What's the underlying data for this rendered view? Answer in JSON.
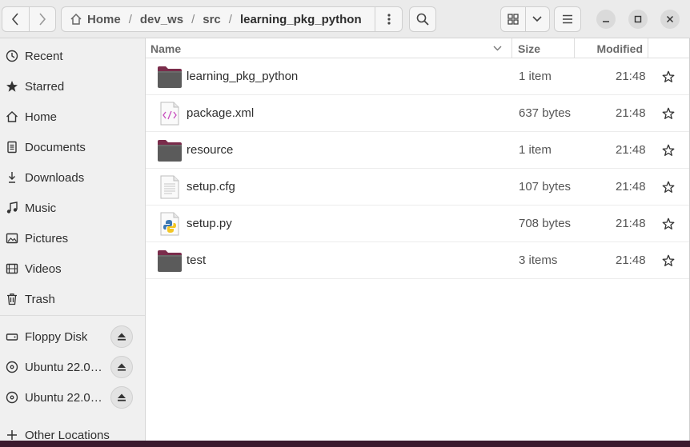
{
  "header": {
    "path": [
      "Home",
      "dev_ws",
      "src",
      "learning_pkg_python"
    ],
    "separator": "/"
  },
  "sidebar": {
    "places": [
      {
        "label": "Recent",
        "icon": "clock-icon"
      },
      {
        "label": "Starred",
        "icon": "star-icon"
      },
      {
        "label": "Home",
        "icon": "home-icon"
      },
      {
        "label": "Documents",
        "icon": "document-icon"
      },
      {
        "label": "Downloads",
        "icon": "download-icon"
      },
      {
        "label": "Music",
        "icon": "music-icon"
      },
      {
        "label": "Pictures",
        "icon": "picture-icon"
      },
      {
        "label": "Videos",
        "icon": "video-icon"
      },
      {
        "label": "Trash",
        "icon": "trash-icon"
      }
    ],
    "devices": [
      {
        "label": "Floppy Disk",
        "icon": "drive-icon"
      },
      {
        "label": "Ubuntu 22.0…",
        "icon": "disc-icon"
      },
      {
        "label": "Ubuntu 22.0…",
        "icon": "disc-icon"
      }
    ],
    "other": {
      "label": "Other Locations",
      "icon": "plus-icon"
    }
  },
  "columns": {
    "name": "Name",
    "size": "Size",
    "modified": "Modified"
  },
  "files": [
    {
      "name": "learning_pkg_python",
      "size": "1 item",
      "modified": "21:48",
      "type": "folder"
    },
    {
      "name": "package.xml",
      "size": "637 bytes",
      "modified": "21:48",
      "type": "xml"
    },
    {
      "name": "resource",
      "size": "1 item",
      "modified": "21:48",
      "type": "folder"
    },
    {
      "name": "setup.cfg",
      "size": "107 bytes",
      "modified": "21:48",
      "type": "text"
    },
    {
      "name": "setup.py",
      "size": "708 bytes",
      "modified": "21:48",
      "type": "python"
    },
    {
      "name": "test",
      "size": "3 items",
      "modified": "21:48",
      "type": "folder"
    }
  ],
  "colors": {
    "folder_top": "#7a2c4b",
    "folder_body": "#5b5b5b",
    "xml_accent": "#c84fbf",
    "python_blue": "#3b78b4",
    "python_yellow": "#f3c623"
  }
}
